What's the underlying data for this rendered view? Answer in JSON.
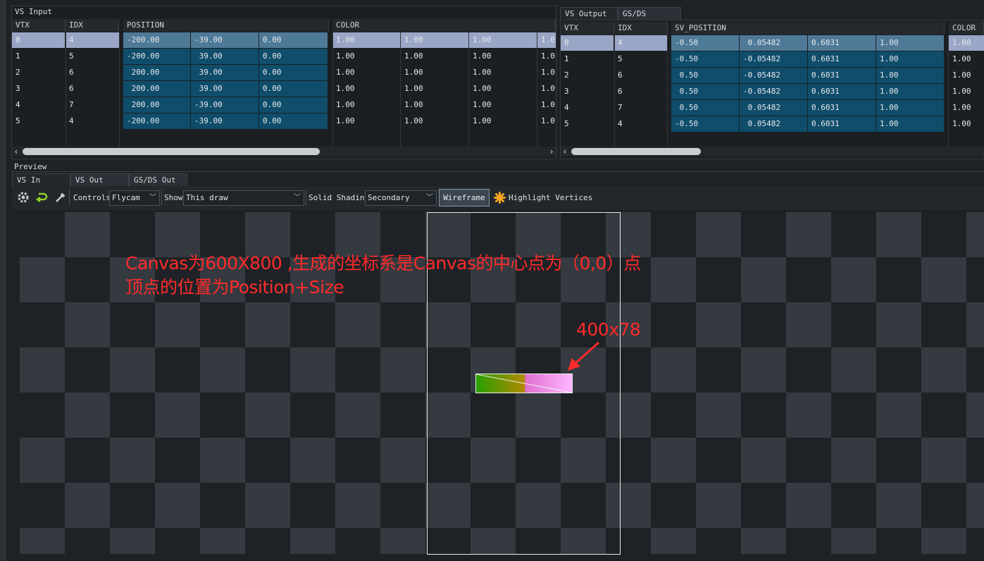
{
  "vs_input": {
    "panel_title": "VS Input",
    "columns": [
      "VTX",
      "IDX",
      "POSITION",
      "COLOR"
    ],
    "rows": [
      {
        "vtx": "0",
        "idx": "4",
        "pos": [
          "-200.00",
          "-39.00",
          "0.00"
        ],
        "color": [
          "1.00",
          "1.00",
          "1.00",
          "1.0"
        ]
      },
      {
        "vtx": "1",
        "idx": "5",
        "pos": [
          "-200.00",
          "39.00",
          "0.00"
        ],
        "color": [
          "1.00",
          "1.00",
          "1.00",
          "1.0"
        ]
      },
      {
        "vtx": "2",
        "idx": "6",
        "pos": [
          "200.00",
          "39.00",
          "0.00"
        ],
        "color": [
          "1.00",
          "1.00",
          "1.00",
          "1.0"
        ]
      },
      {
        "vtx": "3",
        "idx": "6",
        "pos": [
          "200.00",
          "39.00",
          "0.00"
        ],
        "color": [
          "1.00",
          "1.00",
          "1.00",
          "1.0"
        ]
      },
      {
        "vtx": "4",
        "idx": "7",
        "pos": [
          "200.00",
          "-39.00",
          "0.00"
        ],
        "color": [
          "1.00",
          "1.00",
          "1.00",
          "1.0"
        ]
      },
      {
        "vtx": "5",
        "idx": "4",
        "pos": [
          "-200.00",
          "-39.00",
          "0.00"
        ],
        "color": [
          "1.00",
          "1.00",
          "1.00",
          "1.0"
        ]
      }
    ]
  },
  "output_tabs": [
    "VS Output",
    "GS/DS Output"
  ],
  "vs_output": {
    "columns": [
      "VTX",
      "IDX",
      "SV_POSITION",
      "COLOR"
    ],
    "rows": [
      {
        "vtx": "0",
        "idx": "4",
        "pos": [
          "-0.50",
          "0.05482",
          "0.6031",
          "1.00"
        ],
        "color": "1.00"
      },
      {
        "vtx": "1",
        "idx": "5",
        "pos": [
          "-0.50",
          "-0.05482",
          "0.6031",
          "1.00"
        ],
        "color": "1.00"
      },
      {
        "vtx": "2",
        "idx": "6",
        "pos": [
          "0.50",
          "-0.05482",
          "0.6031",
          "1.00"
        ],
        "color": "1.00"
      },
      {
        "vtx": "3",
        "idx": "6",
        "pos": [
          "0.50",
          "-0.05482",
          "0.6031",
          "1.00"
        ],
        "color": "1.00"
      },
      {
        "vtx": "4",
        "idx": "7",
        "pos": [
          "0.50",
          "0.05482",
          "0.6031",
          "1.00"
        ],
        "color": "1.00"
      },
      {
        "vtx": "5",
        "idx": "4",
        "pos": [
          "-0.50",
          "0.05482",
          "0.6031",
          "1.00"
        ],
        "color": "1.00"
      }
    ]
  },
  "preview": {
    "title": "Preview",
    "tabs": [
      "VS In",
      "VS Out",
      "GS/DS Out"
    ],
    "toolbar": {
      "controls_label": "Controls",
      "controls_value": "Flycam",
      "show_label": "Show",
      "show_value": "This draw",
      "shading_label": "Solid Shading",
      "shading_value": "Secondary",
      "wireframe_label": "Wireframe",
      "highlight_label": "Highlight Vertices"
    }
  },
  "annotations": {
    "line1": "Canvas为600X800 ,生成的坐标系是Canvas的中心点为（0,0）点",
    "line2": "顶点的位置为Position+Size",
    "size_label": "400x78"
  },
  "colors": {
    "selected_row": "#9aa6c6",
    "position_cell": "#0f4d6b",
    "annotation": "#ff2b2b",
    "checker_dark": "#1e2226",
    "checker_light": "#343a40"
  }
}
